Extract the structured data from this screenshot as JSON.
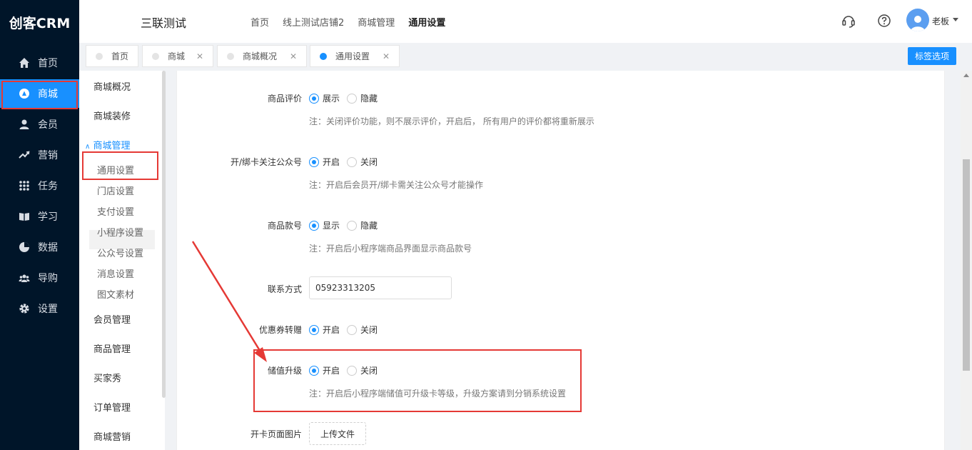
{
  "app": {
    "logo": "创客CRM",
    "shop_name": "三联测试",
    "user": "老板"
  },
  "topnav": [
    "首页",
    "线上测试店铺2",
    "商城管理",
    "通用设置"
  ],
  "leftnav": [
    {
      "label": "首页",
      "icon": "home-icon"
    },
    {
      "label": "商城",
      "icon": "shop-icon",
      "active": true
    },
    {
      "label": "会员",
      "icon": "user-icon"
    },
    {
      "label": "营销",
      "icon": "trend-icon"
    },
    {
      "label": "任务",
      "icon": "grid-icon"
    },
    {
      "label": "学习",
      "icon": "book-icon"
    },
    {
      "label": "数据",
      "icon": "pie-icon"
    },
    {
      "label": "导购",
      "icon": "team-icon"
    },
    {
      "label": "设置",
      "icon": "gear-icon"
    }
  ],
  "tabs": [
    {
      "label": "首页",
      "closable": false
    },
    {
      "label": "商城",
      "closable": true
    },
    {
      "label": "商城概况",
      "closable": true
    },
    {
      "label": "通用设置",
      "closable": true,
      "active": true
    }
  ],
  "tag_button": "标签选项",
  "subnav": {
    "top": [
      "商城概况",
      "商城装修"
    ],
    "group": "商城管理",
    "children": [
      "通用设置",
      "门店设置",
      "支付设置",
      "小程序设置",
      "公众号设置",
      "消息设置",
      "图文素材"
    ],
    "bottom": [
      "会员管理",
      "商品管理",
      "买家秀",
      "订单管理",
      "商城营销"
    ]
  },
  "form": {
    "review": {
      "label": "商品评价",
      "opt1": "展示",
      "opt2": "隐藏",
      "note": "注：关闭评价功能，则不展示评价，开启后， 所有用户的评价都将重新展示"
    },
    "follow": {
      "label": "开/绑卡关注公众号",
      "opt1": "开启",
      "opt2": "关闭",
      "note": "注：开启后会员开/绑卡需关注公众号才能操作"
    },
    "sku": {
      "label": "商品款号",
      "opt1": "显示",
      "opt2": "隐藏",
      "note": "注：开启后小程序端商品界面显示商品款号"
    },
    "contact": {
      "label": "联系方式",
      "value": "05923313205"
    },
    "coupon": {
      "label": "优惠券转赠",
      "opt1": "开启",
      "opt2": "关闭"
    },
    "upgrade": {
      "label": "储值升级",
      "opt1": "开启",
      "opt2": "关闭",
      "note": "注：开启后小程序端储值可升级卡等级，升级方案请到分销系统设置"
    },
    "cardimg": {
      "label": "开卡页面图片",
      "button": "上传文件"
    }
  },
  "colors": {
    "nav_bg": "#001529",
    "accent": "#1890ff",
    "highlight": "#e53935"
  }
}
